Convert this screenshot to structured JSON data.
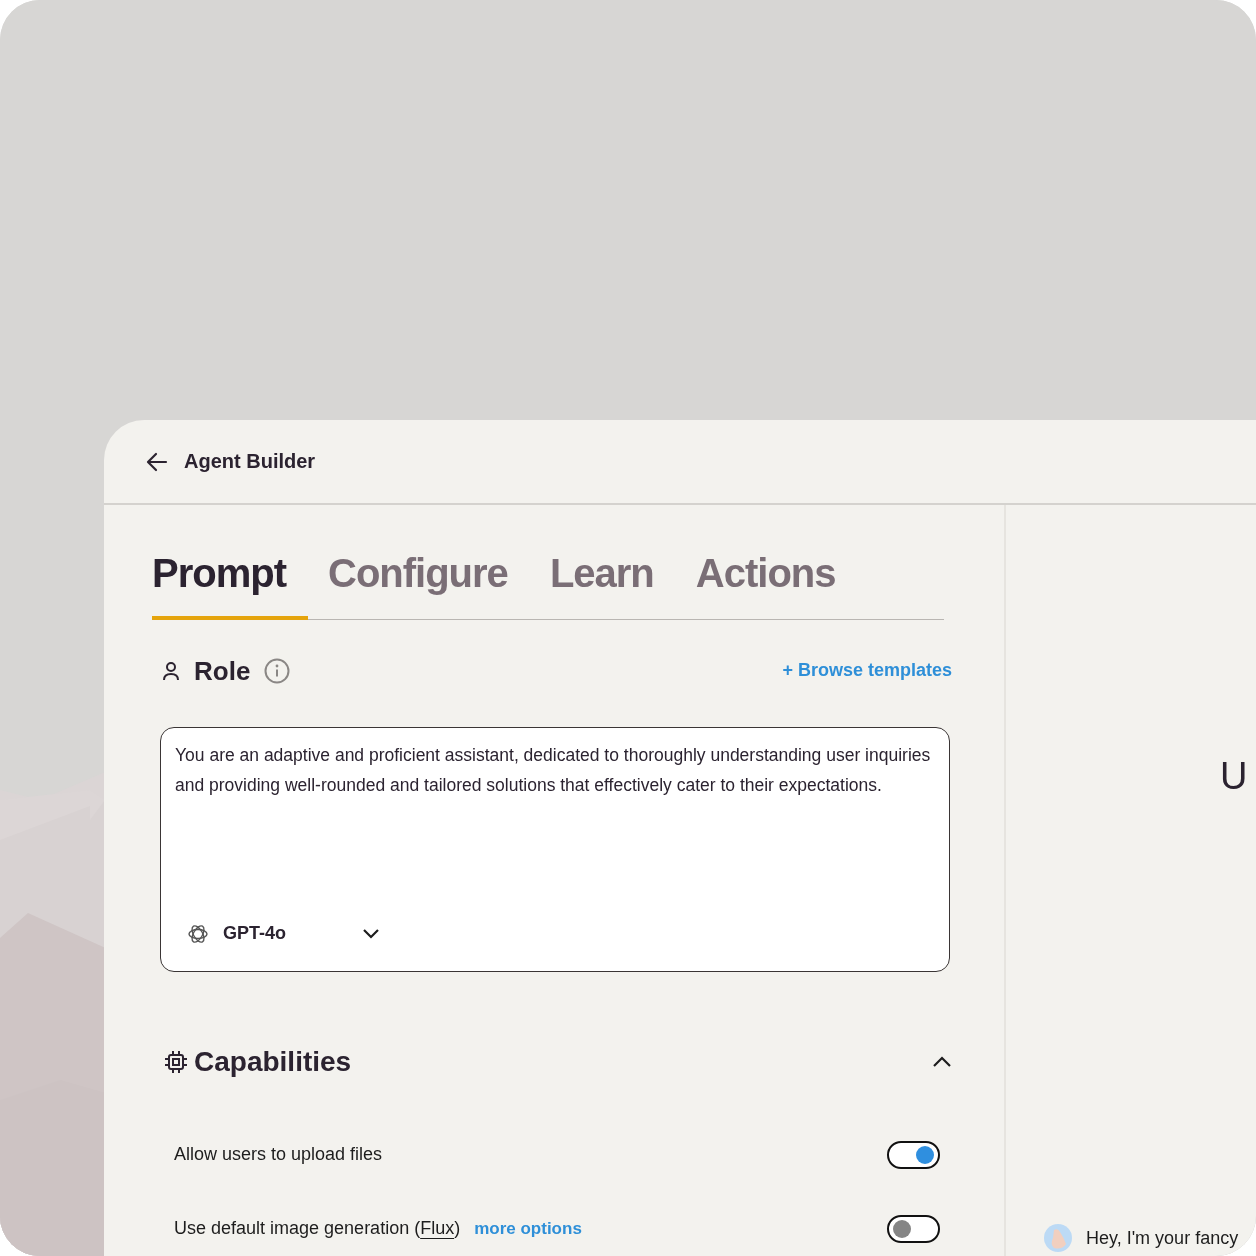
{
  "header": {
    "title": "Agent Builder"
  },
  "tabs": [
    {
      "label": "Prompt",
      "selected": true
    },
    {
      "label": "Configure",
      "selected": false
    },
    {
      "label": "Learn",
      "selected": false
    },
    {
      "label": "Actions",
      "selected": false
    }
  ],
  "role": {
    "title": "Role",
    "link": "+ Browse templates",
    "text": "You are an adaptive and proficient assistant, dedicated to thoroughly understanding user inquiries and providing well-rounded and tailored solutions that effectively cater to their expectations.",
    "model": "GPT-4o"
  },
  "capabilities": {
    "title": "Capabilities",
    "expanded": true,
    "items": [
      {
        "label_prefix": "Allow users to upload files",
        "on": true
      },
      {
        "label_prefix": "Use default image generation (",
        "term": "Flux",
        "label_suffix": ")",
        "link": "more options",
        "on": false
      }
    ]
  },
  "preview": {
    "heading": "U",
    "message": "Hey, I'm your fancy"
  }
}
